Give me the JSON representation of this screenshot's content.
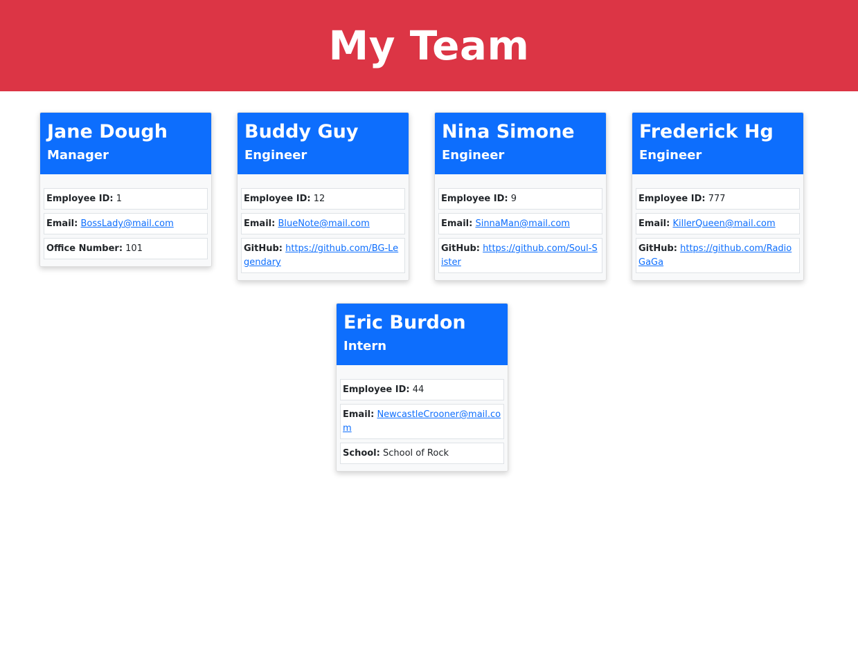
{
  "header": {
    "title": "My Team"
  },
  "labels": {
    "id": "Employee ID:",
    "email": "Email:",
    "office": "Office Number:",
    "github": "GitHub:",
    "school": "School:"
  },
  "colors": {
    "banner": "#dc3545",
    "card_header": "#0d6efd",
    "link": "#0d6efd"
  },
  "cards": [
    {
      "name": "Jane Dough",
      "role": "Manager",
      "id": "1",
      "email": "BossLady@mail.com",
      "extra": "101"
    },
    {
      "name": "Buddy Guy",
      "role": "Engineer",
      "id": "12",
      "email": "BlueNote@mail.com",
      "extra": "https://github.com/BG-Legendary"
    },
    {
      "name": "Nina Simone",
      "role": "Engineer",
      "id": "9",
      "email": "SinnaMan@mail.com",
      "extra": "https://github.com/Soul-Sister"
    },
    {
      "name": "Frederick Hg",
      "role": "Engineer",
      "id": "777",
      "email": "KillerQueen@mail.com",
      "extra": "https://github.com/RadioGaGa"
    },
    {
      "name": "Eric Burdon",
      "role": "Intern",
      "id": "44",
      "email": "NewcastleCrooner@mail.com",
      "extra": "School of Rock"
    }
  ]
}
